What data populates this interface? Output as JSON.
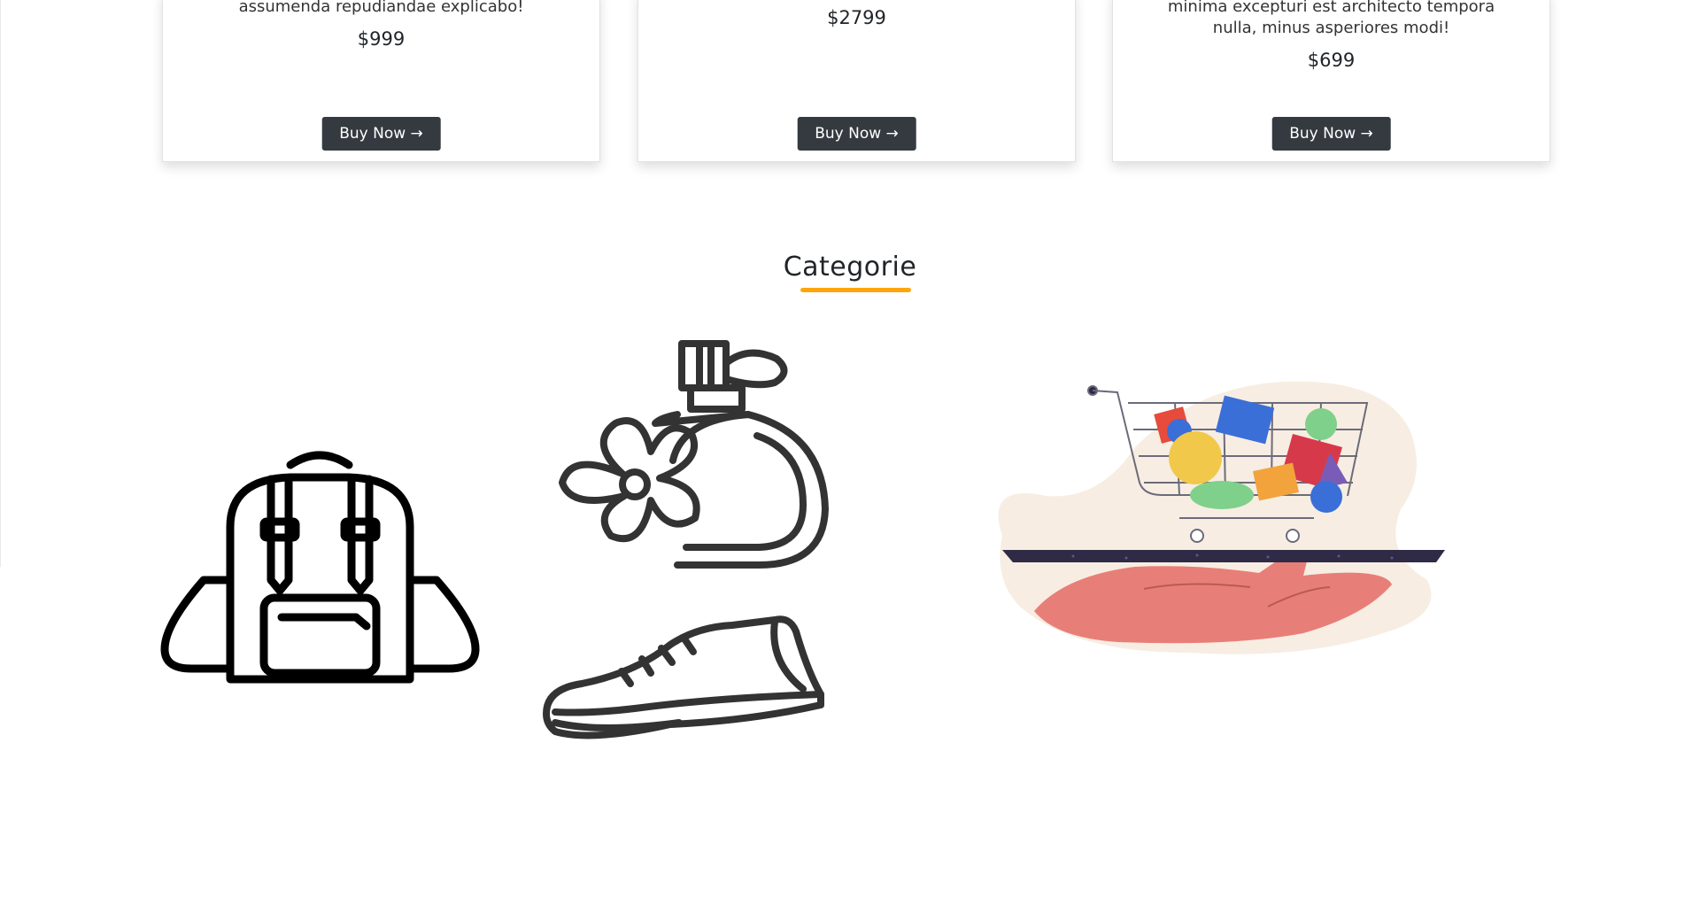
{
  "products": [
    {
      "description": "assumenda repudiandae explicabo!",
      "price": "$999",
      "button_label": "Buy Now →"
    },
    {
      "description": "",
      "price": "$2799",
      "button_label": "Buy Now →"
    },
    {
      "description": "minima excepturi est architecto tempora nulla, minus asperiores modi!",
      "price": "$699",
      "button_label": "Buy Now →"
    }
  ],
  "categories_section": {
    "title": "Categorie",
    "accent_color": "#ffa50a",
    "items": [
      {
        "icon": "backpack-icon"
      },
      {
        "icon": "perfume-icon"
      },
      {
        "icon": "sneaker-icon"
      },
      {
        "icon": "shopping-cart-illustration"
      }
    ]
  },
  "colors": {
    "button_bg": "#343a40",
    "button_text": "#ffffff",
    "illustration_blob": "#f7ede2",
    "illustration_hand": "#e77f78",
    "illustration_tray": "#2f2a45"
  }
}
